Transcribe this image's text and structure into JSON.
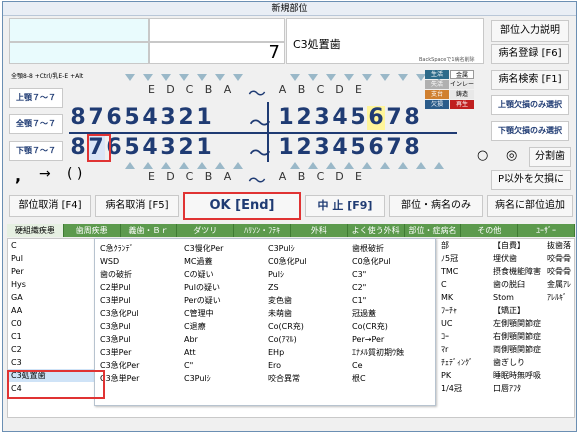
{
  "window": {
    "title": "新規部位"
  },
  "top": {
    "count_value": "7",
    "diagnosis_value": "C3処置歯",
    "backspace_hint": "BackSpaceで1病名削除",
    "btn_input_help": "部位入力説明",
    "btn_register": "病名登録 [F6]",
    "btn_search": "病名検索 [F1]"
  },
  "shortcut_hint": "全顎8-8 +Ctrl/乳E-E +Alt",
  "arch": {
    "upper_label": "上顎７～７",
    "full_label": "全顎７～７",
    "lower_label": "下顎７～７",
    "letters_left": [
      "E",
      "D",
      "C",
      "B",
      "A"
    ],
    "letters_right": [
      "A",
      "B",
      "C",
      "D",
      "E"
    ],
    "digits_left": [
      "8",
      "7",
      "6",
      "5",
      "4",
      "3",
      "2",
      "1"
    ],
    "digits_right": [
      "1",
      "2",
      "3",
      "4",
      "5",
      "6",
      "7",
      "8"
    ],
    "tilde": "～",
    "selected_tooth": "7",
    "highlight_tooth": "6"
  },
  "legend": [
    {
      "label": "生活",
      "color": "#2e6b8a"
    },
    {
      "label": "金属",
      "color": "#ffffff"
    },
    {
      "label": "失活",
      "color": "#b0b0b0"
    },
    {
      "label": "インレー",
      "color": "#e8e8e8"
    },
    {
      "label": "支台",
      "color": "#d08030"
    },
    {
      "label": "鋳造",
      "color": "#e8e8e8"
    },
    {
      "label": "欠損",
      "color": "#2b5c8a"
    },
    {
      "label": "再生",
      "color": "#c02020"
    }
  ],
  "side_buttons": {
    "upper_only": "上顎欠損のみ選択",
    "lower_only": "下顎欠損のみ選択",
    "radio1": "○",
    "radio2": "◎",
    "split_tooth": "分割歯",
    "p_except": "P以外を欠損に"
  },
  "keys": {
    "comma": ",",
    "arrow": "→",
    "paren": "( )"
  },
  "action_bar": {
    "cancel_site": "部位取消 [F4]",
    "cancel_name": "病名取消 [F5]",
    "ok": "OK [End]",
    "stop": "中 止 [F9]",
    "site_name_only": "部位・病名のみ",
    "add_to_name": "病名に部位追加"
  },
  "tabs": [
    "硬組織疾患",
    "歯周疾患",
    "義歯・Ｂｒ",
    "ダツリ",
    "ﾊﾘｿﾝ・ﾌﾃｷ",
    "外科",
    "よく使う外科",
    "部位・症病名",
    "その他",
    "ﾕｰｻﾞｰ"
  ],
  "grid_col1": [
    "C",
    "Pul",
    "Per",
    "Hys",
    "GA",
    "AA",
    "C0",
    "C1",
    "C2",
    "C3",
    "C3処置歯",
    "C4"
  ],
  "popup_cols": [
    [
      "C急ｸﾗﾝﾃﾞ",
      "WSD",
      "歯の破折",
      "C2単Pul",
      "C3単Pul",
      "C3急化Pul",
      "C3急Pul",
      "C3急Pul",
      "C3単Per",
      "C3急化Per",
      "C3急単Per"
    ],
    [
      "C3慢化Per",
      "MC過蓋",
      "Cの疑い",
      "Pulの疑い",
      "Perの疑い",
      "C管理中",
      "C退療",
      "Abr",
      "Att",
      "C\"",
      "C3Pulｼ"
    ],
    [
      "C3Pulｼ",
      "C0急化Pul",
      "Pulｼ",
      "ZS",
      "変色歯",
      "未萌歯",
      "Co(CR充)",
      "Co(ｱﾏﾙ)",
      "EHp",
      "Ero",
      "咬合異常"
    ],
    [
      "歯根破折",
      "C0急化Pul",
      "C3\"",
      "C2\"",
      "C1\"",
      "冠過蓋",
      "Co(CR充)",
      "Per→Per",
      "ｴﾅﾒﾙ質初期ｳ蝕",
      "Ce",
      "根C"
    ]
  ],
  "grid_right_col1": [
    "部",
    "ﾉ5冠",
    "TMC",
    "C",
    "MK",
    "ﾌｰﾁｬ",
    "UC",
    "ｺｰ",
    "ﾏr",
    "ﾁｪﾃﾞｨﾝｸﾞ",
    "PK",
    "1/4冠"
  ],
  "grid_right_col2": [
    "【自費】",
    "埋伏歯",
    "摂食機能障害",
    "歯の脱臼",
    "Stom",
    "【矯正】",
    "左側顎関節症",
    "右側顎関節症",
    "両側顎関節症",
    "歯ぎしり",
    "睡眠時無呼吸",
    "口唇ｱﾌﾀ"
  ],
  "grid_right_col3": [
    "抜歯落",
    "咬骨骨",
    "咬骨骨",
    "金属ｱﾚ",
    "ｱﾚﾙｷﾞ"
  ]
}
